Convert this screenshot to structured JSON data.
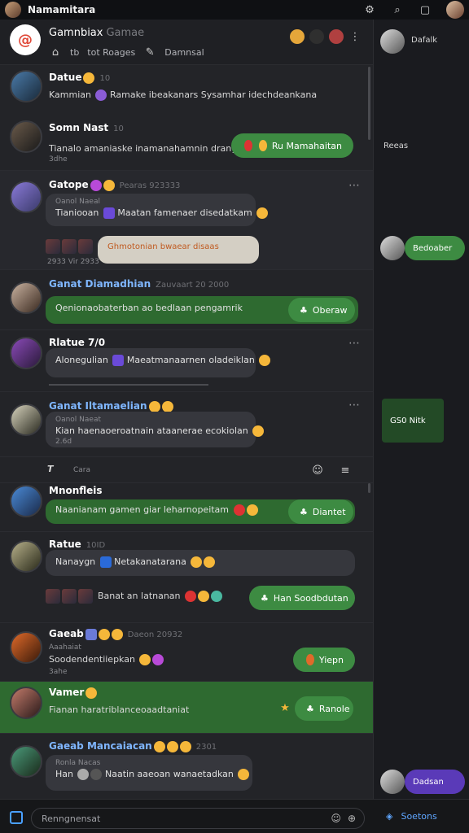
{
  "app": {
    "title": "Namamitara"
  },
  "header": {
    "name": "Gamnbiax",
    "name_suffix": "Gamae",
    "sub_items": [
      "tb",
      "tot Roages",
      "Damnsal"
    ],
    "logo_letter": "@"
  },
  "posts": [
    {
      "name": "Datue",
      "meta": "10",
      "text": "Kammian",
      "text2": "Ramake ibeakanars Sysamhar idechdeankana"
    },
    {
      "name": "Somn Nast",
      "meta": "10",
      "text": "Tianalo amaniaske inamanahamnin drangaran",
      "sub": "3dhe",
      "button": "Ru Mamahaitan"
    },
    {
      "name": "Gatope",
      "meta": "Pearas 923333",
      "sub": "Oanol Naeal",
      "text": "Tianiooan",
      "text2": "Maatan famenaer disedatkam",
      "pill": "Ghmotonian bwaear disaas",
      "thumbs_sub": "2933 Vir 2933"
    },
    {
      "name": "Ganat Diamadhian",
      "meta": "Zauvaart 20  2000",
      "text": "Qenionaobaterban ao bedlaan pengamrik",
      "button": "Oberaw"
    },
    {
      "name": "Rlatue 7/0",
      "sub": "",
      "text": "Alonegulian",
      "text2": "Maeatmanaarnen oladeiklan"
    },
    {
      "name": "Ganat Iltamaelian",
      "sub": "Oanol Naeat",
      "text": "Kian haenaoeroatnain ataanerae ecokiolan",
      "sub2": "2.6d"
    },
    {
      "name": "Mnonfleis",
      "meta": "",
      "text": "Naanianam gamen giar leharnopeitam",
      "button": "Diantet"
    },
    {
      "name": "Ratue",
      "meta": "10ID",
      "text": "Nanaygn",
      "text2": "Netakanatarana",
      "row": "Banat an latnanan",
      "button": "Han Soodbdutan"
    },
    {
      "name": "Gaeab",
      "meta": "Daeon 20932",
      "sub": "Aaahaiat",
      "text": "Soodendentiiepkan",
      "sub2": "3ahe",
      "button": "Yiepn"
    },
    {
      "name": "Vamer",
      "text": "Fianan haratriblanceoaadtaniat",
      "button": "Ranole"
    },
    {
      "name": "Gaeab Mancaiacan",
      "meta": "2301",
      "sub": "Ronla Nacas",
      "text": "Han",
      "text2": "Naatin aaeoan wanaetadkan"
    }
  ],
  "side": {
    "top_name": "Dafalk",
    "label": "Reeas",
    "pill_1": "Bedoaber",
    "card": "GS0 Nitk",
    "bottom_pill": "Dadsan"
  },
  "composer": {
    "placeholder": "Renngnensat",
    "right_label": "Soetons"
  },
  "middle_row": {
    "label": "Cara",
    "t": "T"
  },
  "colors": {
    "accent_green": "#3d8b42",
    "accent_blue": "#4aa0ff",
    "bg": "#232428"
  }
}
